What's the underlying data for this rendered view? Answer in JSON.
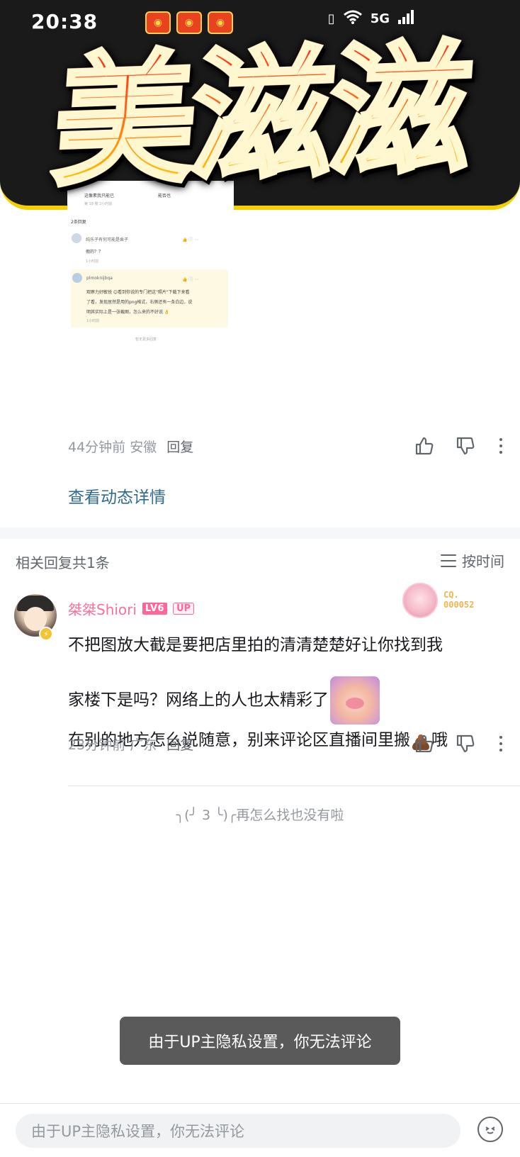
{
  "status_bar": {
    "time": "20:38",
    "network": "5G"
  },
  "sticker": {
    "text": "美滋滋"
  },
  "embedded_screenshot": {
    "top_line": "这像素我只能已",
    "top_line_tail": "能否也",
    "top_sub": "第 18 楼 2小时前",
    "reply_count": "2条回复",
    "reply1_user": "纯乐子有何可能是乘子",
    "reply1_text": "假的？？",
    "reply1_sub": "1小时前",
    "reply2_user": "plmoknijbqa",
    "reply2_text_1": "观察力好敏锐 😊看到你说的专门把这\"照片\"下载下来看",
    "reply2_text_2": "了看，发现居然是用的png格式，右侧还有一条白边，说",
    "reply2_text_3": "明其实际上是一张截图，怎么来的不好说 👌",
    "reply2_sub": "1小时前",
    "footer": "暂无更多回复"
  },
  "main_comment": {
    "time_location": "44分钟前 安徽",
    "reply_label": "回复",
    "detail_link": "查看动态详情"
  },
  "related": {
    "title": "相关回复共1条",
    "sort_label": "按时间"
  },
  "reply": {
    "username": "桀桀Shiori",
    "level": "LV6",
    "up_badge": "UP",
    "fan_badge_line1": "CQ.",
    "fan_badge_line2": "000052",
    "text_line1": "不把图放大截是要把店里拍的清清楚楚好让你找到我",
    "text_line2": "家楼下是吗？网络上的人也太精彩了",
    "text_line3a": "在别的地方怎么说随意，别来评论区直播间里搬",
    "text_line3b": "哦",
    "time_location": "23分钟前 广东",
    "reply_label": "回复"
  },
  "end_note": "╮(╯ 3 ╰)╭再怎么找也没有啦",
  "toast": "由于UP主隐私设置，你无法评论",
  "bottom_bar": {
    "input_placeholder": "由于UP主隐私设置，你无法评论",
    "emoji_icon": "emoji-icon"
  },
  "colors": {
    "pink_accent": "#fb7299",
    "link_blue": "#2f6b8f",
    "secondary_text": "#9499a0"
  }
}
